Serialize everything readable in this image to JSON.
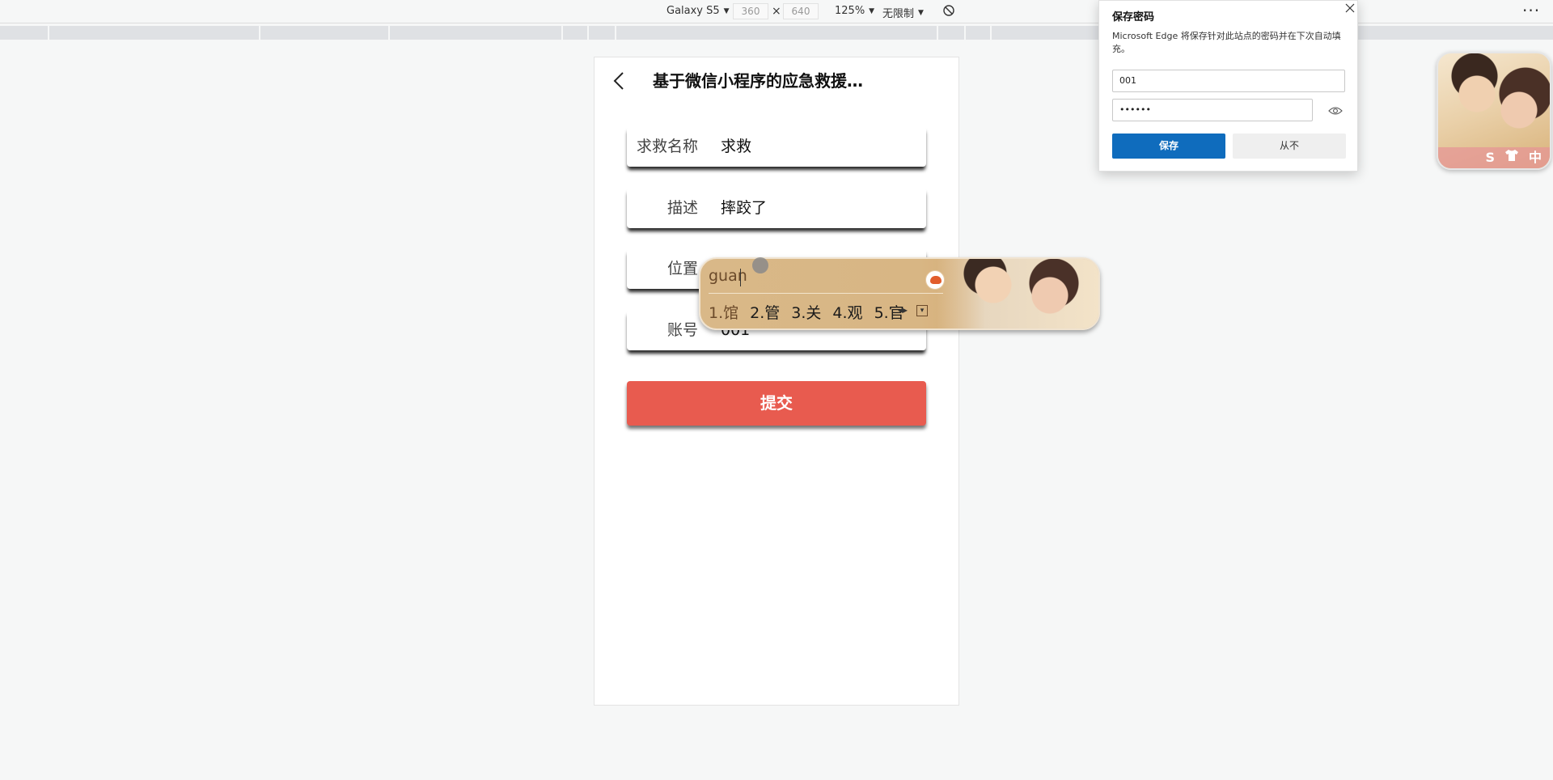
{
  "devtools": {
    "device": "Galaxy S5",
    "width": "360",
    "height": "640",
    "times": "×",
    "zoom": "125%",
    "throttle": "无限制"
  },
  "app": {
    "title": "基于微信小程序的应急救援…",
    "fields": [
      {
        "label": "求救名称",
        "value": "求救"
      },
      {
        "label": "描述",
        "value": "摔跤了"
      },
      {
        "label": "位置",
        "value": ""
      },
      {
        "label": "账号",
        "value": "001"
      }
    ],
    "submit_label": "提交"
  },
  "ime": {
    "pinyin": "guan",
    "candidates": [
      "1.馆",
      "2.管",
      "3.关",
      "4.观",
      "5.官"
    ]
  },
  "password_dialog": {
    "title": "保存密码",
    "description": "Microsoft Edge 将保存针对此站点的密码并在下次自动填充。",
    "username": "001",
    "password_mask": "••••••",
    "save_label": "保存",
    "never_label": "从不"
  },
  "avatar_widget": {
    "badges": [
      "S",
      "中"
    ]
  },
  "colors": {
    "submit": "#e85b4f",
    "save": "#0f6cbd"
  }
}
